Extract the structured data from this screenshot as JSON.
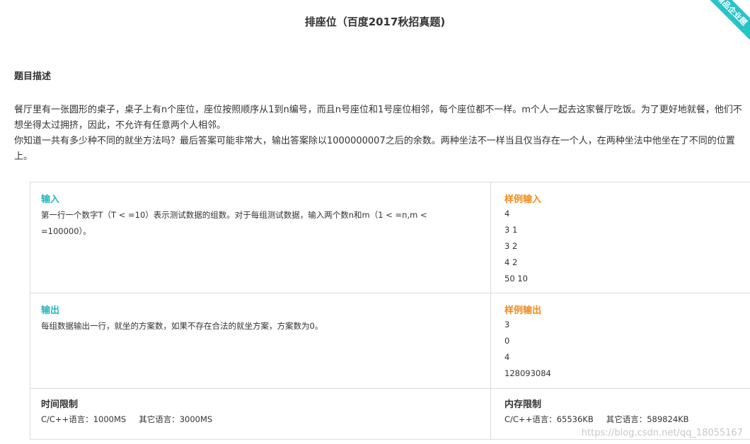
{
  "title": "排座位（百度2017秋招真题)",
  "ribbon": "精品企业题",
  "description": {
    "heading": "题目描述",
    "paragraph1": "餐厅里有一张圆形的桌子，桌子上有n个座位，座位按照顺序从1到n编号，而且n号座位和1号座位相邻，每个座位都不一样。m个人一起去这家餐厅吃饭。为了更好地就餐，他们不想坐得太过拥挤，因此，不允许有任意两个人相邻。",
    "paragraph2": "你知道一共有多少种不同的就坐方法吗？最后答案可能非常大，输出答案除以1000000007之后的余数。两种坐法不一样当且仅当存在一个人，在两种坐法中他坐在了不同的位置上。"
  },
  "input": {
    "label": "输入",
    "text": "第一行一个数字T（T < =10）表示测试数据的组数。对于每组测试数据，输入两个数n和m（1 < =n,m < =100000）。"
  },
  "sample_input": {
    "label": "样例输入",
    "lines": [
      "4",
      "3 1",
      "3 2",
      "4 2",
      "50 10"
    ]
  },
  "output": {
    "label": "输出",
    "text": "每组数据输出一行，就坐的方案数，如果不存在合法的就坐方案，方案数为0。"
  },
  "sample_output": {
    "label": "样例输出",
    "lines": [
      "3",
      "0",
      "4",
      "128093084"
    ]
  },
  "time_limit": {
    "label": "时间限制",
    "cpp": "C/C++语言：1000MS",
    "other": "其它语言：3000MS"
  },
  "memory_limit": {
    "label": "内存限制",
    "cpp": "C/C++语言：65536KB",
    "other": "其它语言：589824KB"
  },
  "watermark": "https://blog.csdn.net/qq_18055167",
  "colors": {
    "accent_teal": "#22b5bc",
    "accent_orange": "#f08a1c",
    "ribbon": "#27c3c9"
  }
}
